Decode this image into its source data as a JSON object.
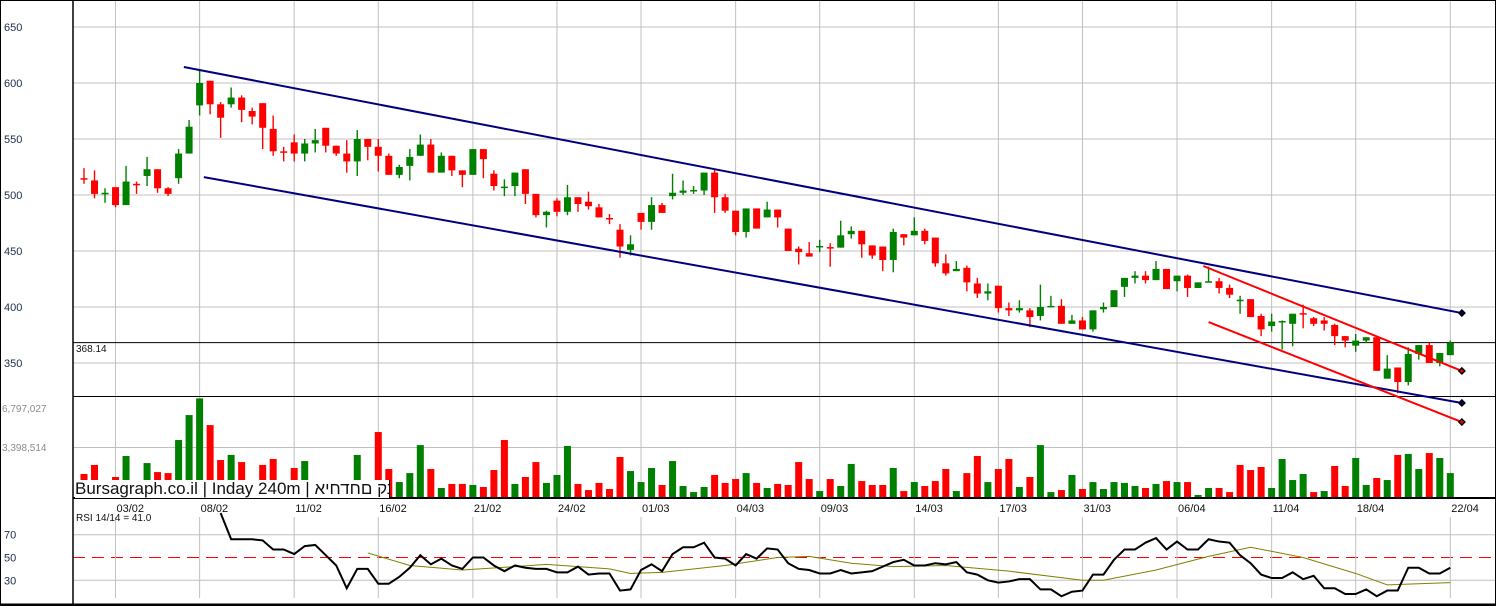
{
  "chart_data": {
    "type": "candlestick",
    "watermark": {
      "site": "Bursagraph.co.il",
      "interval": "Inday 240m",
      "name": "איחדחם קבוצה",
      "separator": " | "
    },
    "last_price_label": "368.14",
    "last_price": 368.14,
    "price_axis": {
      "ticks": [
        650,
        600,
        550,
        500,
        450,
        400,
        350
      ],
      "ylim": [
        330,
        675
      ]
    },
    "volume_axis": {
      "tick_labels": [
        "6,797,027",
        "3,398,514"
      ],
      "ticks": [
        6797027,
        3398514
      ]
    },
    "rsi": {
      "label": "RSI 14/14 = 41.0",
      "period": 14,
      "value": 41.0,
      "ticks": [
        "70",
        "50",
        "30"
      ],
      "tick_values": [
        70,
        50,
        30
      ],
      "midline": 50
    },
    "x_ticks": [
      {
        "label": "03/02",
        "bar": 3
      },
      {
        "label": "08/02",
        "bar": 11
      },
      {
        "label": "11/02",
        "bar": 20
      },
      {
        "label": "16/02",
        "bar": 28
      },
      {
        "label": "21/02",
        "bar": 37
      },
      {
        "label": "24/02",
        "bar": 45
      },
      {
        "label": "01/03",
        "bar": 53
      },
      {
        "label": "04/03",
        "bar": 62
      },
      {
        "label": "09/03",
        "bar": 70
      },
      {
        "label": "14/03",
        "bar": 79
      },
      {
        "label": "17/03",
        "bar": 87
      },
      {
        "label": "31/03",
        "bar": 95
      },
      {
        "label": "06/04",
        "bar": 104
      },
      {
        "label": "11/04",
        "bar": 113
      },
      {
        "label": "18/04",
        "bar": 121
      },
      {
        "label": "22/04",
        "bar": 130
      }
    ],
    "ohlc_fields": [
      "open",
      "high",
      "low",
      "close"
    ],
    "candles": [
      [
        515,
        524,
        510,
        514
      ],
      [
        513,
        522,
        497,
        501
      ],
      [
        501,
        506,
        493,
        502
      ],
      [
        507,
        507,
        489,
        491
      ],
      [
        491,
        526,
        491,
        512
      ],
      [
        510,
        512,
        501,
        509
      ],
      [
        517,
        534,
        508,
        523
      ],
      [
        523,
        523,
        502,
        506
      ],
      [
        506,
        507,
        499,
        501
      ],
      [
        515,
        541,
        510,
        537
      ],
      [
        537,
        567,
        537,
        561
      ],
      [
        580,
        612,
        571,
        600
      ],
      [
        602,
        602,
        572,
        581
      ],
      [
        581,
        583,
        551,
        569
      ],
      [
        581,
        596,
        578,
        587
      ],
      [
        587,
        589,
        565,
        576
      ],
      [
        575,
        578,
        563,
        570
      ],
      [
        582,
        582,
        541,
        560
      ],
      [
        559,
        571,
        535,
        539
      ],
      [
        539,
        543,
        530,
        538
      ],
      [
        547,
        554,
        530,
        537
      ],
      [
        537,
        550,
        530,
        546
      ],
      [
        546,
        559,
        538,
        549
      ],
      [
        560,
        560,
        538,
        544
      ],
      [
        544,
        544,
        535,
        537
      ],
      [
        537,
        549,
        520,
        530
      ],
      [
        530,
        558,
        517,
        550
      ],
      [
        550,
        550,
        531,
        543
      ],
      [
        543,
        550,
        521,
        535
      ],
      [
        535,
        537,
        518,
        518
      ],
      [
        518,
        527,
        515,
        525
      ],
      [
        526,
        541,
        513,
        534
      ],
      [
        535,
        554,
        535,
        545
      ],
      [
        545,
        550,
        520,
        520
      ],
      [
        520,
        538,
        520,
        535
      ],
      [
        535,
        535,
        517,
        522
      ],
      [
        522,
        522,
        507,
        518
      ],
      [
        518,
        541,
        518,
        541
      ],
      [
        541,
        541,
        515,
        532
      ],
      [
        519,
        522,
        504,
        508
      ],
      [
        507,
        514,
        499,
        507.5
      ],
      [
        508,
        520,
        499,
        520
      ],
      [
        523,
        523,
        492,
        501
      ],
      [
        501,
        501,
        480,
        482
      ],
      [
        482,
        486,
        471,
        485
      ],
      [
        495,
        497,
        481,
        485
      ],
      [
        485,
        509,
        482,
        498
      ],
      [
        498,
        498,
        485,
        492
      ],
      [
        494,
        503,
        487,
        490
      ],
      [
        489,
        492,
        480,
        480
      ],
      [
        479.5,
        483,
        474,
        479
      ],
      [
        469,
        474,
        444,
        454
      ],
      [
        451,
        464,
        446,
        456
      ],
      [
        484,
        484,
        469,
        476
      ],
      [
        476,
        498,
        469,
        491
      ],
      [
        491,
        493,
        484,
        484
      ],
      [
        499,
        519,
        496,
        502
      ],
      [
        502,
        513,
        500,
        504
      ],
      [
        504,
        508,
        501,
        504.5
      ],
      [
        504,
        520,
        500,
        520
      ],
      [
        520,
        523,
        484,
        498
      ],
      [
        498,
        501,
        484,
        486
      ],
      [
        486,
        486,
        464,
        467
      ],
      [
        467,
        488,
        462,
        488
      ],
      [
        488,
        488,
        470,
        470
      ],
      [
        480,
        494,
        480,
        487
      ],
      [
        487,
        487,
        471,
        480
      ],
      [
        470,
        470,
        450,
        450
      ],
      [
        452,
        454,
        438,
        449
      ],
      [
        448,
        458,
        445,
        445
      ],
      [
        454,
        460,
        449,
        454.5
      ],
      [
        453.5,
        457,
        436,
        453
      ],
      [
        453,
        477,
        453,
        464
      ],
      [
        465,
        472,
        461,
        468
      ],
      [
        468,
        468,
        444,
        456
      ],
      [
        455,
        455,
        443,
        446
      ],
      [
        454,
        454,
        432,
        442
      ],
      [
        442,
        470,
        431,
        467
      ],
      [
        465,
        465,
        455,
        462
      ],
      [
        464,
        480,
        464,
        468
      ],
      [
        468,
        470,
        456,
        459
      ],
      [
        462,
        462,
        436,
        439
      ],
      [
        439,
        447,
        428,
        430
      ],
      [
        432,
        441,
        432,
        434
      ],
      [
        435,
        437,
        414,
        422
      ],
      [
        421,
        426,
        408,
        412
      ],
      [
        412,
        421,
        406,
        414
      ],
      [
        419,
        419,
        395,
        399
      ],
      [
        399,
        404,
        392,
        397
      ],
      [
        397,
        406,
        395,
        399
      ],
      [
        397,
        399,
        382,
        391
      ],
      [
        392,
        420,
        388,
        400
      ],
      [
        400.5,
        410,
        400,
        401
      ],
      [
        401,
        407,
        385,
        385
      ],
      [
        385,
        393,
        385,
        388
      ],
      [
        388,
        391,
        380,
        380
      ],
      [
        380,
        397,
        378,
        397
      ],
      [
        398,
        404,
        395,
        400
      ],
      [
        400,
        415,
        400,
        415
      ],
      [
        418,
        426,
        409,
        426
      ],
      [
        426,
        432,
        421,
        428
      ],
      [
        428,
        432,
        421,
        424
      ],
      [
        424,
        441,
        424,
        434
      ],
      [
        434,
        434,
        416,
        416
      ],
      [
        423,
        428,
        414,
        428
      ],
      [
        428,
        429,
        409,
        417
      ],
      [
        417,
        422,
        417,
        422
      ],
      [
        422.5,
        436,
        422.5,
        423
      ],
      [
        423,
        426,
        412,
        417
      ],
      [
        417,
        420,
        408,
        411
      ],
      [
        406,
        410,
        394,
        406.5
      ],
      [
        407,
        407,
        391,
        391
      ],
      [
        392,
        394,
        374,
        380
      ],
      [
        383,
        394,
        378,
        387
      ],
      [
        387,
        388,
        362,
        387.5
      ],
      [
        385,
        394,
        365,
        394
      ],
      [
        394.5,
        402,
        381,
        394
      ],
      [
        390,
        391,
        383,
        385
      ],
      [
        388,
        391,
        379,
        385
      ],
      [
        384,
        385,
        366,
        374
      ],
      [
        374,
        374,
        364,
        370
      ],
      [
        365.5,
        376,
        360,
        370
      ],
      [
        370,
        373,
        368,
        373
      ],
      [
        373,
        373,
        343,
        343
      ],
      [
        336,
        357,
        336,
        345
      ],
      [
        346,
        346,
        323,
        333
      ],
      [
        333,
        364,
        330,
        358
      ],
      [
        358,
        366,
        353,
        366
      ],
      [
        366,
        368,
        350,
        350
      ],
      [
        350,
        359,
        347,
        359
      ],
      [
        357,
        370,
        357,
        368
      ]
    ],
    "volume_millions": [
      1.59,
      2.21,
      1.0,
      1.38,
      2.83,
      1.0,
      2.34,
      1.72,
      1.65,
      3.93,
      5.65,
      6.8,
      4.96,
      2.55,
      2.9,
      2.41,
      1.0,
      2.21,
      2.62,
      1.0,
      2.0,
      2.48,
      1.0,
      1.0,
      1.0,
      1.0,
      2.9,
      1.0,
      4.48,
      1.93,
      1.03,
      1.65,
      3.58,
      1.93,
      0.62,
      0.9,
      0.9,
      0.83,
      0.69,
      1.86,
      3.93,
      0.9,
      1.38,
      2.41,
      0.97,
      1.52,
      3.52,
      0.9,
      0.48,
      0.97,
      0.55,
      2.76,
      1.79,
      1.03,
      2.0,
      0.83,
      2.48,
      0.76,
      0.34,
      0.69,
      1.52,
      0.97,
      1.24,
      1.65,
      0.97,
      0.62,
      0.9,
      0.83,
      2.41,
      1.24,
      0.41,
      1.24,
      0.76,
      2.28,
      1.1,
      0.83,
      0.83,
      2.0,
      0.41,
      1.03,
      0.76,
      1.1,
      1.93,
      0.41,
      1.65,
      2.83,
      1.03,
      1.93,
      2.62,
      0.69,
      1.38,
      3.58,
      0.34,
      0.48,
      1.52,
      0.55,
      1.03,
      0.55,
      1.03,
      0.97,
      0.76,
      0.62,
      0.9,
      1.1,
      1.03,
      1.03,
      0.14,
      0.62,
      0.62,
      0.34,
      2.21,
      1.86,
      2.07,
      0.62,
      2.62,
      1.17,
      1.59,
      0.34,
      0.41,
      2.14,
      0.76,
      2.69,
      0.83,
      1.31,
      1.17,
      2.9,
      2.97,
      1.93,
      3.03,
      2.69,
      1.65
    ],
    "rsi_values": [
      null,
      null,
      null,
      null,
      null,
      null,
      null,
      null,
      null,
      null,
      null,
      null,
      null,
      89,
      66,
      66,
      66,
      65,
      57,
      57,
      53,
      60,
      61,
      52,
      43,
      23,
      40,
      40,
      27,
      27,
      33,
      41,
      52,
      44,
      49,
      43,
      40,
      50,
      50,
      43,
      38,
      43,
      41,
      40,
      40,
      37,
      37,
      42,
      35,
      36,
      36,
      21,
      22,
      39,
      44,
      38,
      53,
      59,
      59,
      63,
      50,
      49,
      43,
      53,
      49,
      58,
      57,
      45,
      40,
      39,
      36,
      36,
      39,
      36,
      37,
      38,
      42,
      46,
      48,
      43,
      43,
      45,
      44,
      46,
      37,
      35,
      30,
      28,
      29,
      31,
      31,
      22,
      22,
      16,
      20,
      21,
      35,
      35,
      48,
      57,
      57,
      63,
      67,
      57,
      64,
      57,
      57,
      66,
      64,
      63,
      52,
      45,
      35,
      32,
      32,
      37,
      31,
      34,
      23,
      23,
      18,
      18,
      22,
      16,
      21,
      21,
      41,
      41,
      36,
      36,
      41
    ],
    "rsi_average_points": [
      {
        "bar": 27,
        "value": 54
      },
      {
        "bar": 31,
        "value": 43
      },
      {
        "bar": 36,
        "value": 39
      },
      {
        "bar": 41,
        "value": 42
      },
      {
        "bar": 44,
        "value": 44
      },
      {
        "bar": 50,
        "value": 40
      },
      {
        "bar": 52,
        "value": 36
      },
      {
        "bar": 55,
        "value": 37
      },
      {
        "bar": 61,
        "value": 43
      },
      {
        "bar": 66,
        "value": 50
      },
      {
        "bar": 69,
        "value": 51
      },
      {
        "bar": 73,
        "value": 45
      },
      {
        "bar": 77,
        "value": 42
      },
      {
        "bar": 82,
        "value": 43
      },
      {
        "bar": 88,
        "value": 38
      },
      {
        "bar": 95,
        "value": 30
      },
      {
        "bar": 97,
        "value": 30
      },
      {
        "bar": 102,
        "value": 39
      },
      {
        "bar": 107,
        "value": 51
      },
      {
        "bar": 111,
        "value": 59
      },
      {
        "bar": 116,
        "value": 50
      },
      {
        "bar": 121,
        "value": 36
      },
      {
        "bar": 124,
        "value": 26
      },
      {
        "bar": 130,
        "value": 28
      }
    ],
    "trendlines": [
      {
        "color": "#00007f",
        "from": {
          "bar": 9.5,
          "price": 614.3
        },
        "to": {
          "bar": 131.1,
          "price": 394.6
        },
        "end_marker": true
      },
      {
        "color": "#00007f",
        "from": {
          "bar": 11.4,
          "price": 516.0
        },
        "to": {
          "bar": 131.1,
          "price": 314.3
        },
        "end_marker": true
      },
      {
        "color": "#ff0000",
        "from": {
          "bar": 106.5,
          "price": 436.6
        },
        "to": {
          "bar": 131.1,
          "price": 342.9
        },
        "end_marker": true
      },
      {
        "color": "#ff0000",
        "from": {
          "bar": 107.0,
          "price": 386.6
        },
        "to": {
          "bar": 131.1,
          "price": 297.3
        },
        "end_marker": true
      }
    ],
    "colors": {
      "up": "#008000",
      "down": "#ff0000",
      "channel": "#00007f",
      "rsi_line": "#000000",
      "rsi_average": "#808000",
      "midline": "#ff0000",
      "grid": "#c0c0c0"
    },
    "grid": true
  }
}
